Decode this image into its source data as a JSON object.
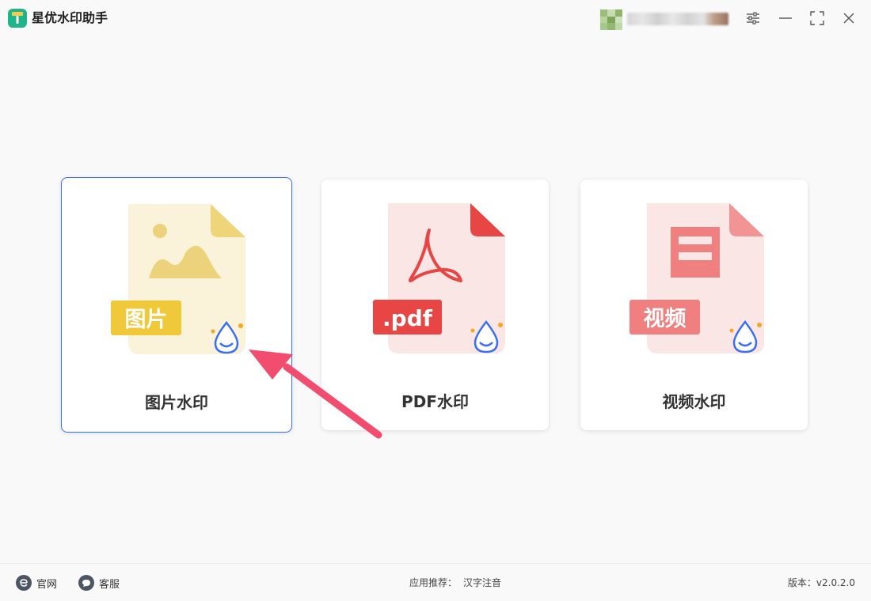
{
  "app": {
    "title": "星优水印助手",
    "logo_icon": "brush-logo-icon",
    "brand_color": "#1fb48a"
  },
  "window_controls": {
    "settings_icon": "sliders-icon",
    "minimize_icon": "minimize-icon",
    "maximize_icon": "maximize-icon",
    "close_icon": "close-icon"
  },
  "cards": [
    {
      "label": "图片水印",
      "badge": "图片",
      "icon": "image-file-icon",
      "badge_color": "#f0c93a",
      "doc_color": "#fbf3d9",
      "selected": true
    },
    {
      "label": "PDF水印",
      "badge": ".pdf",
      "icon": "pdf-file-icon",
      "badge_color": "#e84545",
      "doc_color": "#fbe6e6",
      "selected": false
    },
    {
      "label": "视频水印",
      "badge": "视频",
      "icon": "video-file-icon",
      "badge_color": "#f08080",
      "doc_color": "#fbe6e6",
      "selected": false
    }
  ],
  "footer": {
    "website_label": "官网",
    "website_icon": "browser-e-icon",
    "support_label": "客服",
    "support_icon": "chat-bubble-icon",
    "recommend_prefix": "应用推荐：",
    "recommend_app": "汉字注音",
    "version": "版本：v2.0.2.0"
  },
  "accent_color": "#3b6ef0"
}
